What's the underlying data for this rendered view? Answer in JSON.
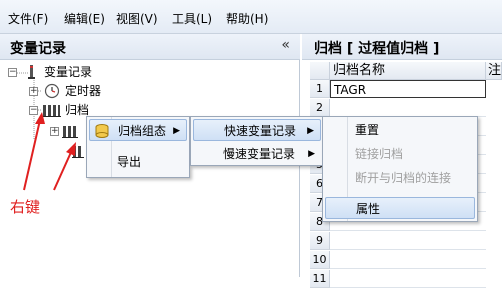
{
  "menubar": {
    "items": [
      {
        "label": "文件(F)"
      },
      {
        "label": "编辑(E)"
      },
      {
        "label": "视图(V)"
      },
      {
        "label": "工具(L)"
      },
      {
        "label": "帮助(H)"
      }
    ]
  },
  "left_panel": {
    "title": "变量记录",
    "collapse_glyph": "«",
    "tree": {
      "root": "变量记录",
      "timer": "定时器",
      "archive": "归档"
    }
  },
  "right_panel": {
    "title": "归档 [ 过程值归档 ]",
    "columns": [
      "归档名称",
      "注"
    ],
    "rows": [
      {
        "num": "1",
        "name": "TAGR"
      },
      {
        "num": "2",
        "name": ""
      },
      {
        "num": "3",
        "name": ""
      },
      {
        "num": "4",
        "name": ""
      },
      {
        "num": "5",
        "name": ""
      },
      {
        "num": "6",
        "name": ""
      },
      {
        "num": "7",
        "name": ""
      },
      {
        "num": "8",
        "name": ""
      },
      {
        "num": "9",
        "name": ""
      },
      {
        "num": "10",
        "name": ""
      },
      {
        "num": "11",
        "name": ""
      }
    ]
  },
  "context_menu": {
    "level1": [
      {
        "label": "归档组态",
        "submenu": true
      },
      {
        "label": "导出",
        "submenu": false
      }
    ],
    "level2": [
      {
        "label": "快速变量记录",
        "submenu": true
      },
      {
        "label": "慢速变量记录",
        "submenu": true
      }
    ],
    "level3": [
      {
        "label": "重置",
        "enabled": true
      },
      {
        "label": "链接归档",
        "enabled": false
      },
      {
        "label": "断开与归档的连接",
        "enabled": false
      },
      {
        "label": "属性",
        "enabled": true
      }
    ]
  },
  "annotation": {
    "text": "右键",
    "color": "#e02020"
  }
}
